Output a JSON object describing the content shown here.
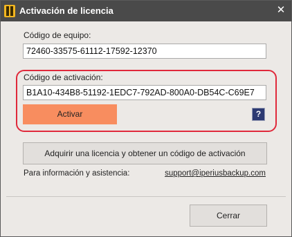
{
  "window": {
    "title": "Activación de licencia",
    "close_glyph": "✕",
    "app_icon": "iperius-logo-icon"
  },
  "machine_code": {
    "label": "Código de equipo:",
    "value": "72460-33575-61112-17592-12370"
  },
  "activation_code": {
    "label": "Código de activación:",
    "value": "B1A10-434B8-51192-1EDC7-792AD-800A0-DB54C-C69E7"
  },
  "buttons": {
    "activate": "Activar",
    "help": "?",
    "acquire": "Adquirir una licencia y obtener un código de activación",
    "close": "Cerrar"
  },
  "info": {
    "text": "Para información y asistencia:",
    "support_email": "support@iperiusbackup.com"
  },
  "colors": {
    "titlebar": "#4a4a4a",
    "accent_button": "#f88d5f",
    "highlight_border": "#e0283a",
    "help_button": "#2d3a72",
    "background": "#ece9e6"
  }
}
